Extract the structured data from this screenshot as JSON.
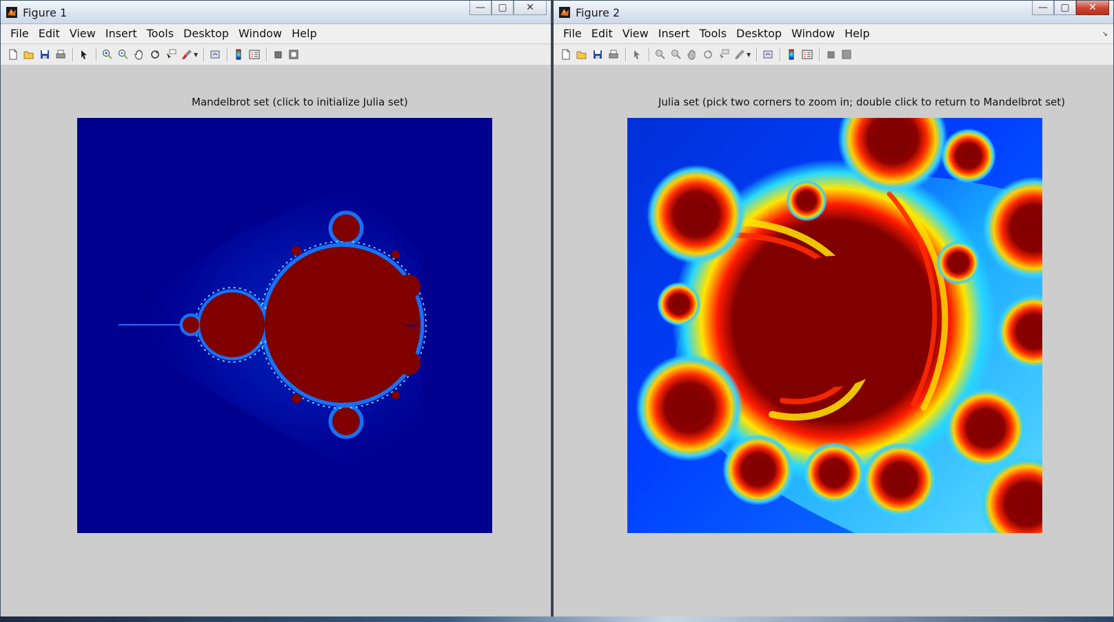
{
  "figure1": {
    "window_title": "Figure 1",
    "axes_title": "Mandelbrot set (click to initialize Julia set)"
  },
  "figure2": {
    "window_title": "Figure 2",
    "axes_title": "Julia set (pick two corners to zoom in; double click to return to Mandelbrot set)"
  },
  "menu": [
    "File",
    "Edit",
    "View",
    "Insert",
    "Tools",
    "Desktop",
    "Window",
    "Help"
  ],
  "caption_buttons": {
    "minimize": "—",
    "maximize": "▢",
    "close": "✕"
  },
  "toolbar_icons": [
    "new-figure-icon",
    "open-file-icon",
    "save-icon",
    "print-icon",
    "edit-plot-icon",
    "zoom-in-icon",
    "zoom-out-icon",
    "pan-icon",
    "rotate-3d-icon",
    "data-cursor-icon",
    "brush-icon",
    "link-plot-icon",
    "insert-colorbar-icon",
    "insert-legend-icon",
    "hide-plot-tools-icon",
    "show-plot-tools-icon"
  ],
  "colors": {
    "mandelbrot_background": "#00008f",
    "mandelbrot_set": "#800000",
    "julia_background": "#0040ff",
    "julia_set": "#800000",
    "jet_cyan": "#26d8ff",
    "jet_yellow": "#ffe600",
    "jet_red": "#ff1a00"
  }
}
